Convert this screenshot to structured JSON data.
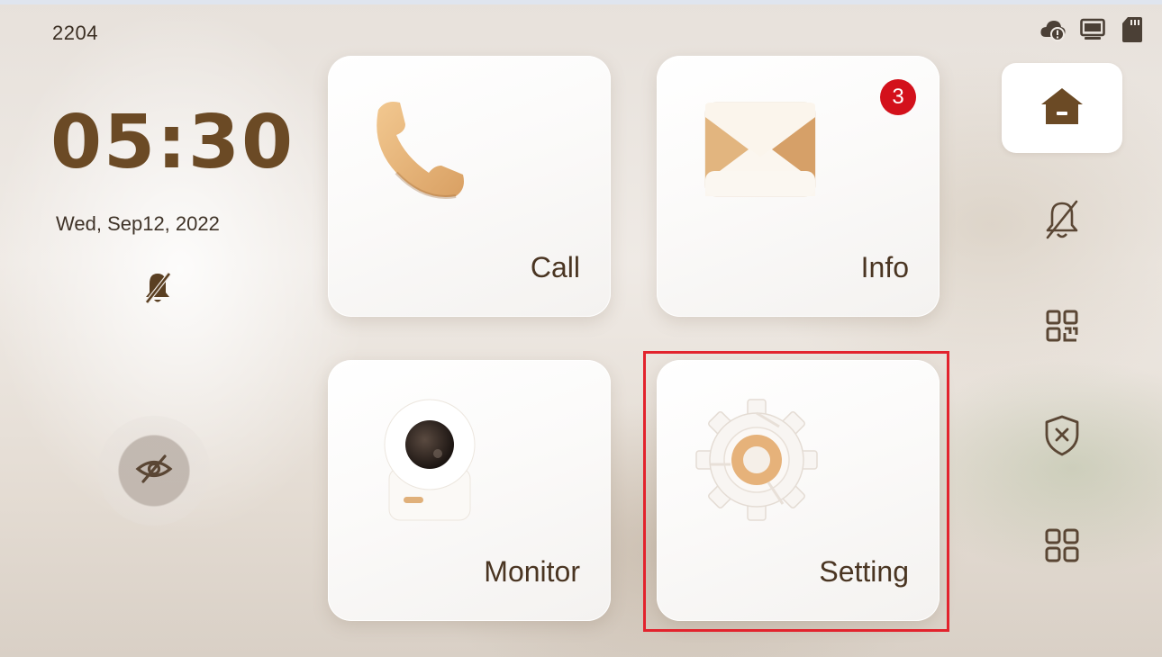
{
  "status_bar": {
    "room_number": "2204",
    "icons": [
      "cloud-warning-icon",
      "monitor-device-icon",
      "sd-card-icon"
    ]
  },
  "left_panel": {
    "time": "05:30",
    "date": "Wed, Sep12, 2022",
    "dnd_icon": "bell-off-icon",
    "privacy_button_icon": "eye-off-icon"
  },
  "tiles": [
    {
      "id": "call",
      "label": "Call",
      "icon": "phone-icon"
    },
    {
      "id": "info",
      "label": "Info",
      "icon": "envelope-icon",
      "badge": "3"
    },
    {
      "id": "monitor",
      "label": "Monitor",
      "icon": "camera-icon"
    },
    {
      "id": "setting",
      "label": "Setting",
      "icon": "gear-icon"
    }
  ],
  "right_nav": [
    {
      "id": "home",
      "icon": "home-icon",
      "active": true
    },
    {
      "id": "dnd",
      "icon": "bell-off-icon",
      "active": false
    },
    {
      "id": "qr",
      "icon": "qr-code-icon",
      "active": false
    },
    {
      "id": "security",
      "icon": "shield-x-icon",
      "active": false
    },
    {
      "id": "apps",
      "icon": "apps-grid-icon",
      "active": false
    }
  ],
  "colors": {
    "accent_brown": "#6b4a25",
    "tile_icon_gold": "#e4b47d",
    "badge_red": "#d3111b",
    "highlight_red": "#e2232d"
  }
}
